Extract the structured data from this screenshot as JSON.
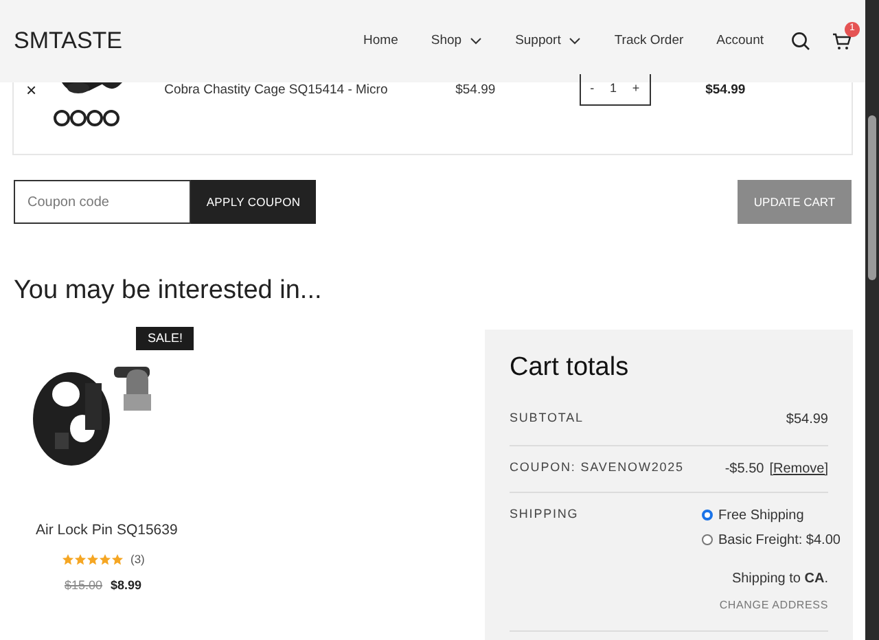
{
  "header": {
    "logo": "SMTASTE",
    "nav": [
      {
        "label": "Home",
        "dropdown": false
      },
      {
        "label": "Shop",
        "dropdown": true
      },
      {
        "label": "Support",
        "dropdown": true
      },
      {
        "label": "Track Order",
        "dropdown": false
      },
      {
        "label": "Account",
        "dropdown": false
      }
    ],
    "cart_count": "1"
  },
  "cart_item": {
    "remove": "×",
    "name": "Cobra Chastity Cage SQ15414 - Micro",
    "price": "$54.99",
    "quantity": {
      "minus": "-",
      "value": "1",
      "plus": "+"
    },
    "subtotal": "$54.99"
  },
  "coupon": {
    "placeholder": "Coupon code",
    "apply": "APPLY COUPON",
    "update": "UPDATE CART"
  },
  "related": {
    "heading": "You may be interested in...",
    "product": {
      "badge": "SALE!",
      "name": "Air Lock Pin SQ15639",
      "stars": 5,
      "reviews": "(3)",
      "old_price": "$15.00",
      "price": "$8.99"
    }
  },
  "totals": {
    "title": "Cart totals",
    "rows": [
      {
        "kind": "amount",
        "label": "SUBTOTAL",
        "value": "$54.99"
      },
      {
        "kind": "coupon",
        "label": "COUPON: SAVENOW2025",
        "value": "-$5.50",
        "link": "[Remove]"
      },
      {
        "kind": "shipping",
        "label": "SHIPPING",
        "options": [
          {
            "label": "Free Shipping",
            "selected": true
          },
          {
            "label": "Basic Freight: $4.00",
            "selected": false
          }
        ],
        "destination": "Shipping to **CA**.",
        "change": "CHANGE ADDRESS"
      }
    ]
  }
}
